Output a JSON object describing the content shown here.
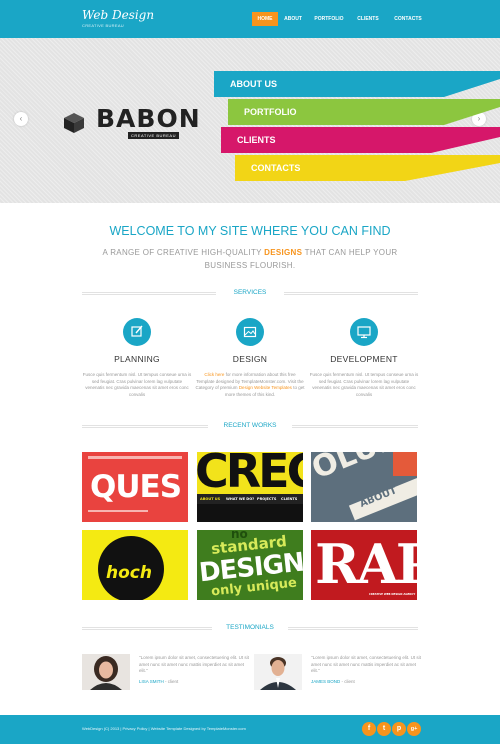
{
  "header": {
    "logo": "Web Design",
    "logo_sub": "CREATIVE BUREAU",
    "nav": [
      {
        "label": "HOME",
        "active": true
      },
      {
        "label": "ABOUT",
        "active": false
      },
      {
        "label": "PORTFOLIO",
        "active": false
      },
      {
        "label": "CLIENTS",
        "active": false
      },
      {
        "label": "CONTACTS",
        "active": false
      }
    ]
  },
  "hero": {
    "brand": "BABON",
    "brand_tag": "CREATIVE BUREAU",
    "prev_icon": "‹",
    "next_icon": "›",
    "ribbons": [
      {
        "label": "ABOUT US",
        "color": "#1aa6c6"
      },
      {
        "label": "PORTFOLIO",
        "color": "#8cc63f"
      },
      {
        "label": "CLIENTS",
        "color": "#d6176a"
      },
      {
        "label": "CONTACTS",
        "color": "#f2d516"
      }
    ]
  },
  "welcome": {
    "title": "WELCOME TO MY SITE WHERE YOU CAN FIND",
    "sub_before": "A RANGE OF CREATIVE HIGH-QUALITY ",
    "sub_highlight": "DESIGNS",
    "sub_after": " THAT CAN HELP YOUR BUSINESS FLOURISH."
  },
  "sections": {
    "services": "SERVICES",
    "recent_works": "RECENT WORKS",
    "testimonials": "TESTIMONIALS"
  },
  "services": [
    {
      "title": "PLANNING",
      "text": "Fusce quis fermentum nisl. Ut tempus conseue urna is sed feugiat. Cras pulvinar lorem lag vulputate venenatis nec gravida maecenas sit amet eros conc convalis"
    },
    {
      "title": "DESIGN",
      "link1": "Click here",
      "text_mid": " for more information about this free Template designed by TemplateMonster.com. Visit the Category of premium ",
      "link2": "Design Website Templates",
      "text_end": " to get more themes of this kind."
    },
    {
      "title": "DEVELOPMENT",
      "text": "Fusce quis fermentum nisl. Ut tempus conseue urna is sed feugiat. Cras pulvinar lorem lag vulputate venenatis nec gravida maecenas sit amet eros conc convalis"
    }
  ],
  "works": [
    {
      "text": "QUES"
    },
    {
      "text": "CREC",
      "nav": [
        "ABOUT US",
        "WHAT WE DO?",
        "PROJECTS",
        "CLIENTS"
      ]
    },
    {
      "text": "OLUNA",
      "text2": "ABOUT"
    },
    {
      "text": "hoch"
    },
    {
      "text": "standard",
      "text2": "DESIGN",
      "text3": "only unique",
      "text4": "no"
    },
    {
      "text": "RAPI",
      "text2": "CREATIVE WEB DESIGN AGENCY"
    }
  ],
  "testimonials": [
    {
      "quote": "\"Lorem ipsum dolor sit amet, consectetuering elit. Ut sit amet nunc sit amet nunc mattis imperdiet ac sit amet elit.\"",
      "name": "LISA SMITH",
      "role": " - client"
    },
    {
      "quote": "\"Lorem ipsum dolor sit amet, consectetuering elit. Ut sit amet nunc sit amet nunc mattis imperdiet ac sit amet elit.\"",
      "name": "JAMES BOND",
      "role": " - client"
    }
  ],
  "footer": {
    "text": "WebDesign (C) 2013 | Privacy Policy | Website Template Designed by TemplateMonster.com",
    "social": [
      {
        "glyph": "f",
        "icon": "facebook-icon"
      },
      {
        "glyph": "t",
        "icon": "twitter-icon"
      },
      {
        "glyph": "p",
        "icon": "pinterest-icon"
      },
      {
        "glyph": "g+",
        "icon": "google-plus-icon"
      }
    ]
  }
}
